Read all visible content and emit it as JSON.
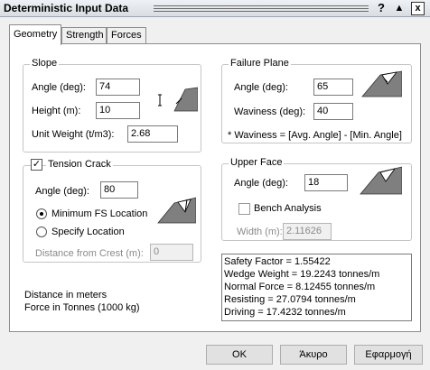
{
  "window": {
    "title": "Deterministic Input Data",
    "help_label": "?",
    "collapse_label": "▲",
    "close_label": "x"
  },
  "tabs": [
    {
      "label": "Geometry",
      "active": true
    },
    {
      "label": "Strength",
      "active": false
    },
    {
      "label": "Forces",
      "active": false
    }
  ],
  "slope": {
    "title": "Slope",
    "angle_label": "Angle (deg):",
    "angle_value": "74",
    "height_label": "Height (m):",
    "height_value": "10",
    "unit_weight_label": "Unit Weight (t/m3):",
    "unit_weight_value": "2.68"
  },
  "tension_crack": {
    "title": "Tension Crack",
    "checked": true,
    "check_mark": "✓",
    "angle_label": "Angle (deg):",
    "angle_value": "80",
    "min_fs_label": "Minimum FS Location",
    "specify_label": "Specify Location",
    "distance_label": "Distance from Crest (m):",
    "distance_value": "0"
  },
  "failure_plane": {
    "title": "Failure Plane",
    "angle_label": "Angle (deg):",
    "angle_value": "65",
    "waviness_label": "Waviness (deg):",
    "waviness_value": "40",
    "note": "* Waviness = [Avg. Angle] - [Min. Angle]"
  },
  "upper_face": {
    "title": "Upper Face",
    "angle_label": "Angle (deg):",
    "angle_value": "18",
    "bench_label": "Bench Analysis",
    "width_label": "Width (m):",
    "width_value": "2.11626"
  },
  "units": {
    "line1": "Distance in meters",
    "line2": "Force in Tonnes (1000 kg)"
  },
  "results": [
    "Safety Factor = 1.55422",
    "Wedge Weight = 19.2243 tonnes/m",
    "Normal Force = 8.12455 tonnes/m",
    "Resisting = 27.0794 tonnes/m",
    "Driving = 17.4232 tonnes/m"
  ],
  "buttons": {
    "ok": "OK",
    "cancel": "Άκυρο",
    "apply": "Εφαρμογή"
  },
  "colors": {
    "shape_fill": "#7f7f7f",
    "panel_bg": "#ffffff",
    "window_bg": "#f0f0f0"
  },
  "icons": [
    "slope-diagram-icon",
    "tension-crack-diagram-icon",
    "failure-plane-diagram-icon",
    "upper-face-diagram-icon"
  ]
}
